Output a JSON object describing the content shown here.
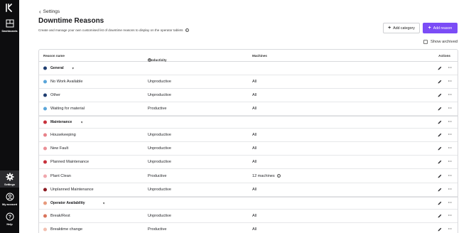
{
  "sidebar": {
    "items": [
      {
        "label": "Dashboards",
        "icon": "dashboard-icon"
      },
      {
        "label": "Settings",
        "icon": "gear-icon"
      },
      {
        "label": "My account",
        "icon": "user-circle-icon"
      },
      {
        "label": "Help",
        "icon": "help-circle-icon"
      }
    ],
    "active": "Settings"
  },
  "header": {
    "back_label": "Settings",
    "title": "Downtime Reasons",
    "subtitle": "Create and manage your own customised list of downtime reasons to display on the operator tablets"
  },
  "actions": {
    "add_category": "Add category",
    "add_reason": "Add reason",
    "show_archived": "Show archived"
  },
  "table": {
    "columns": {
      "name": "Reason name",
      "productivity": "Productivity",
      "machines": "Machines",
      "actions": "Actions"
    },
    "rows": [
      {
        "type": "category",
        "name": "General",
        "color": "#1f3d70"
      },
      {
        "type": "reason",
        "name": "No Work Available",
        "productivity": "Unproductive",
        "machines": "All",
        "color": "#5aa5d9"
      },
      {
        "type": "reason",
        "name": "Other",
        "productivity": "Unproductive",
        "machines": "All",
        "color": "#1f3d70"
      },
      {
        "type": "reason",
        "name": "Waiting for material",
        "productivity": "Productive",
        "machines": "All",
        "color": "#5aa5d9"
      },
      {
        "type": "category",
        "name": "Maintenance",
        "color": "#c8323c"
      },
      {
        "type": "reason",
        "name": "Housekeeping",
        "productivity": "Unproductive",
        "machines": "All",
        "color": "#e8828a"
      },
      {
        "type": "reason",
        "name": "New Fault",
        "productivity": "Unproductive",
        "machines": "All",
        "color": "#ea8f96"
      },
      {
        "type": "reason",
        "name": "Planned Maintenance",
        "productivity": "Unproductive",
        "machines": "All",
        "color": "#c8323c"
      },
      {
        "type": "reason",
        "name": "Plant Clean",
        "productivity": "Productive",
        "machines": "12 machines",
        "machines_info": true,
        "color": "#f0a7ad"
      },
      {
        "type": "reason",
        "name": "Unplanned Maintenance",
        "productivity": "Unproductive",
        "machines": "All",
        "color": "#8c1b22"
      },
      {
        "type": "category",
        "name": "Operator Availability",
        "color": "#e79a7c"
      },
      {
        "type": "reason",
        "name": "Break/Rest",
        "productivity": "Unproductive",
        "machines": "All",
        "color": "#d9745b"
      },
      {
        "type": "reason",
        "name": "Breaktime change",
        "productivity": "Productive",
        "machines": "All",
        "color": "#f2bfb0"
      }
    ]
  }
}
